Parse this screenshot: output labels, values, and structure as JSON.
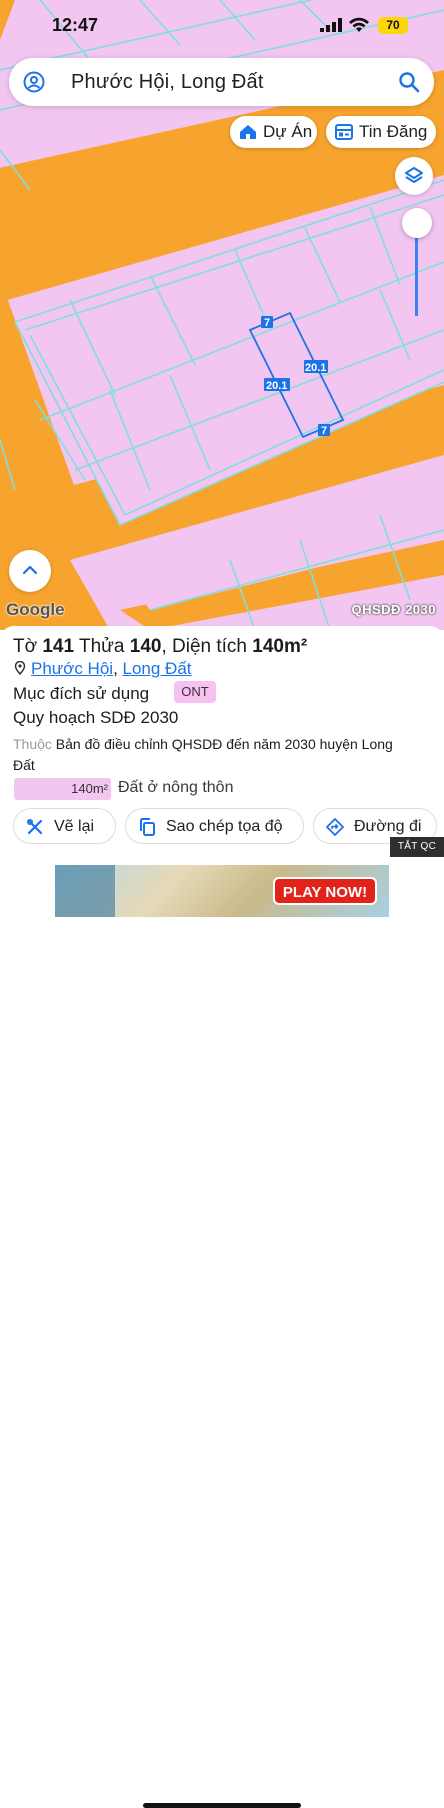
{
  "status": {
    "time": "12:47",
    "battery": "70"
  },
  "search": {
    "query": "Phước Hội, Long Đất",
    "icon_left": "user-circle-icon",
    "icon_right": "search-icon"
  },
  "chips": [
    {
      "label": "Dự Án",
      "icon": "home-icon"
    },
    {
      "label": "Tin Đăng",
      "icon": "list-card-icon"
    }
  ],
  "map": {
    "watermark": "Google",
    "layer_name": "QHSDĐ 2030",
    "parcel_dims": {
      "top": "7",
      "right": "20.1",
      "left": "20.1",
      "bottom": "7"
    },
    "zoom_level": 0.15,
    "colors": {
      "land_residential": "#f3c6f1",
      "road": "#f7a42e",
      "boundary": "#7ee0dc",
      "highlight": "#1a73e8"
    }
  },
  "sheet": {
    "title_prefix": "Tờ ",
    "sheet_no": "141",
    "parcel_prefix": " Thửa ",
    "parcel_no": "140",
    "area_prefix": ", Diện tích ",
    "area": "140m²",
    "ward": "Phước Hội",
    "loc_sep": ", ",
    "district": "Long Đất",
    "purpose_label": "Mục đích sử dụng",
    "purpose_code": "ONT",
    "plan_label": "Quy hoạch SDĐ 2030",
    "belongs_label": "Thuộc",
    "belongs_text": " Bản đồ điều chỉnh QHSDĐ đến năm 2030 huyện Long Đất",
    "legend_area": "140m²",
    "legend_text": "Đất ở nông thôn"
  },
  "actions": [
    {
      "label": "Vẽ lại",
      "icon": "tools-icon"
    },
    {
      "label": "Sao chép tọa độ",
      "icon": "copy-icon"
    },
    {
      "label": "Đường đi",
      "icon": "directions-icon"
    }
  ],
  "ad": {
    "close_label": "TẮT QC",
    "cta": "PLAY NOW!"
  }
}
